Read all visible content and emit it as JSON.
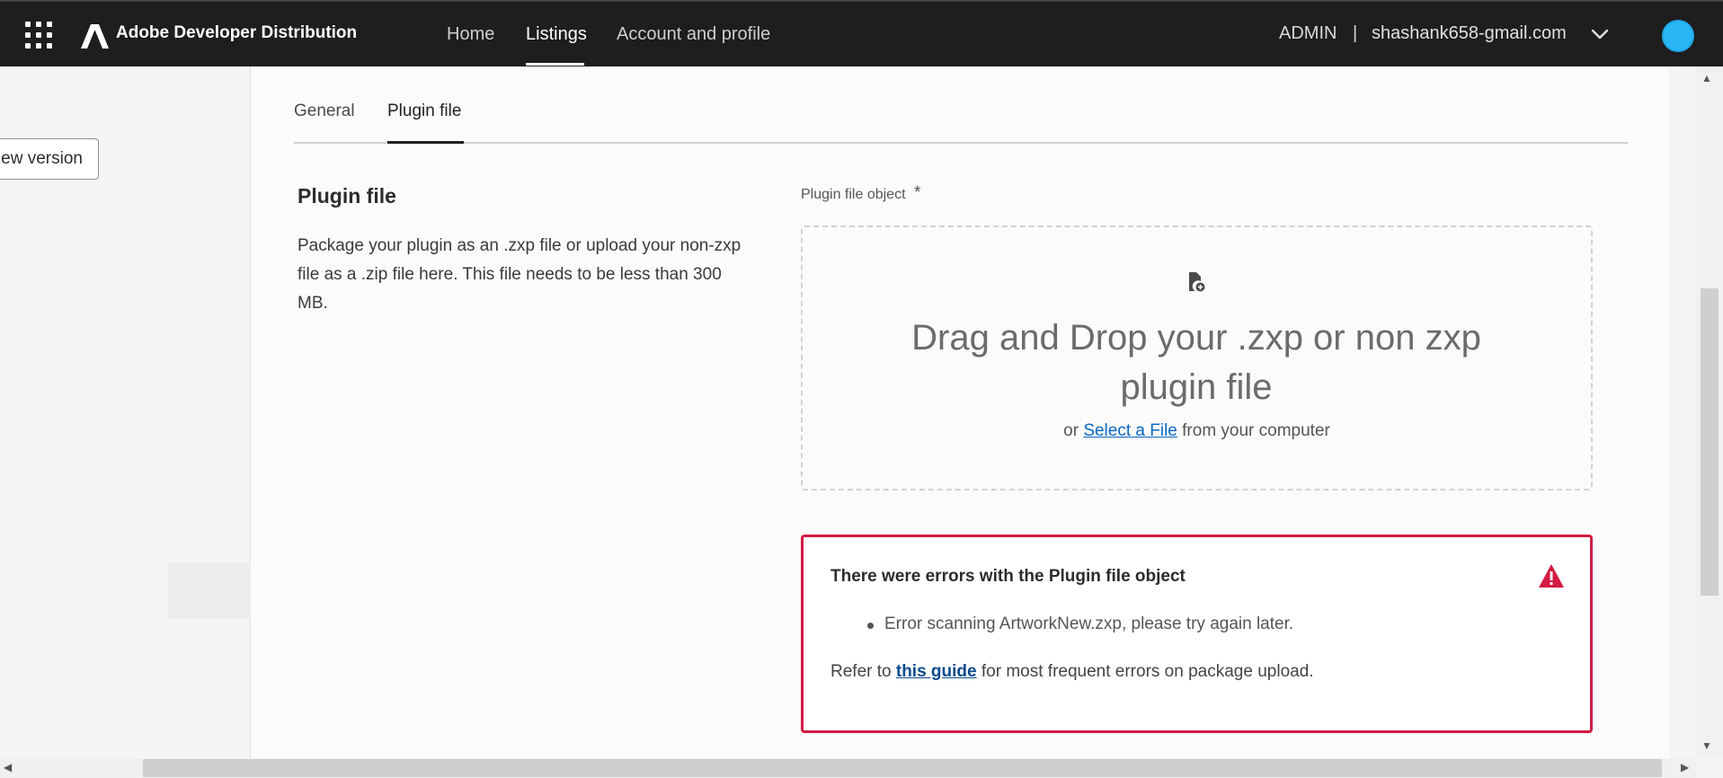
{
  "header": {
    "brand": "Adobe Developer Distribution",
    "nav": [
      {
        "label": "Home"
      },
      {
        "label": "Listings",
        "active": true
      },
      {
        "label": "Account and profile"
      }
    ],
    "role": "ADMIN",
    "separator": "|",
    "account": "shashank658-gmail.com",
    "icons": {
      "apps": "apps-grid-icon",
      "logo": "adobe-logo-icon",
      "menu": "chevron-down-icon",
      "avatar": "avatar"
    }
  },
  "sidebar": {
    "new_version_label": "ew version"
  },
  "tabs": [
    {
      "label": "General"
    },
    {
      "label": "Plugin file",
      "active": true
    }
  ],
  "plugin_file": {
    "title": "Plugin file",
    "description": "Package your plugin as an .zxp file or upload your non-zxp file as a .zip file here. This file needs to be less than 300 MB.",
    "field_label": "Plugin file object",
    "required_mark": "*",
    "dropzone": {
      "title": "Drag and Drop your .zxp or non zxp plugin file",
      "prefix": "or",
      "link": "Select a File",
      "suffix": "from your computer"
    }
  },
  "error": {
    "title": "There were errors with the Plugin file object",
    "items": [
      "Error scanning ArtworkNew.zxp, please try again later."
    ],
    "footer_prefix": "Refer to",
    "footer_link": "this guide",
    "footer_suffix": "for most frequent errors on package upload."
  },
  "colors": {
    "topbar": "#1e1e1e",
    "error_border": "#d31b43",
    "link": "#0a67c2"
  }
}
